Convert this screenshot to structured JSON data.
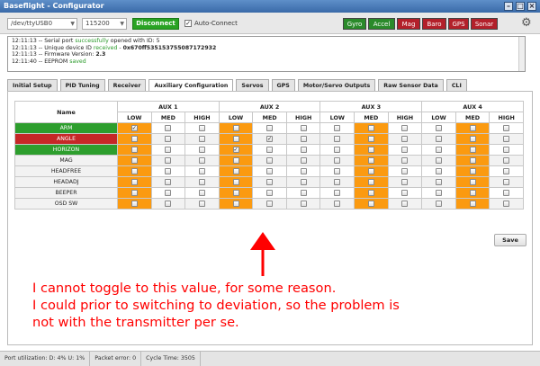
{
  "window": {
    "title": "Baseflight - Configurator",
    "buttons": [
      "–",
      "□",
      "×"
    ]
  },
  "header": {
    "port": "/dev/ttyUSB0",
    "baud": "115200",
    "connect_label": "Disconnect",
    "auto_connect_checked": true,
    "auto_connect_label": "Auto-Connect",
    "sensors": [
      {
        "label": "Gyro",
        "color": "#2a8a2a"
      },
      {
        "label": "Accel",
        "color": "#2a8a2a"
      },
      {
        "label": "Mag",
        "color": "#b3202a"
      },
      {
        "label": "Baro",
        "color": "#b3202a"
      },
      {
        "label": "GPS",
        "color": "#b3202a"
      },
      {
        "label": "Sonar",
        "color": "#b3202a"
      }
    ],
    "settings_icon": "gear-icon"
  },
  "log": [
    {
      "time": "12:11:13",
      "pre": "Serial port ",
      "ok": "successfully",
      "post": " opened with ID: 5",
      "bold": ""
    },
    {
      "time": "12:11:13",
      "pre": "Unique device ID ",
      "ok": "received",
      "post": " - ",
      "bold": "0x670ff535153755087172932"
    },
    {
      "time": "12:11:13",
      "pre": "Firmware Version: ",
      "ok": "",
      "post": "",
      "bold": "2.3"
    },
    {
      "time": "12:11:40",
      "pre": "EEPROM ",
      "ok": "saved",
      "post": "",
      "bold": ""
    }
  ],
  "tabs": [
    {
      "label": "Initial Setup",
      "active": false
    },
    {
      "label": "PID Tuning",
      "active": false
    },
    {
      "label": "Receiver",
      "active": false
    },
    {
      "label": "Auxiliary Configuration",
      "active": true
    },
    {
      "label": "Servos",
      "active": false
    },
    {
      "label": "GPS",
      "active": false
    },
    {
      "label": "Motor/Servo Outputs",
      "active": false
    },
    {
      "label": "Raw Sensor Data",
      "active": false
    },
    {
      "label": "CLI",
      "active": false
    }
  ],
  "aux_table": {
    "name_header": "Name",
    "aux_headers": [
      "AUX 1",
      "AUX 2",
      "AUX 3",
      "AUX 4"
    ],
    "level_headers": [
      "LOW",
      "MED",
      "HIGH"
    ],
    "rows": [
      {
        "name": "ARM",
        "status": "active",
        "checked": [
          1,
          0,
          0,
          0,
          0,
          0,
          0,
          0,
          0,
          0,
          0,
          0
        ]
      },
      {
        "name": "ANGLE",
        "status": "error",
        "checked": [
          0,
          0,
          0,
          0,
          1,
          0,
          0,
          0,
          0,
          0,
          0,
          0
        ]
      },
      {
        "name": "HORIZON",
        "status": "active",
        "checked": [
          0,
          0,
          0,
          1,
          0,
          0,
          0,
          0,
          0,
          0,
          0,
          0
        ]
      },
      {
        "name": "MAG",
        "status": "none",
        "checked": [
          0,
          0,
          0,
          0,
          0,
          0,
          0,
          0,
          0,
          0,
          0,
          0
        ]
      },
      {
        "name": "HEADFREE",
        "status": "none",
        "checked": [
          0,
          0,
          0,
          0,
          0,
          0,
          0,
          0,
          0,
          0,
          0,
          0
        ]
      },
      {
        "name": "HEADADJ",
        "status": "none",
        "checked": [
          0,
          0,
          0,
          0,
          0,
          0,
          0,
          0,
          0,
          0,
          0,
          0
        ]
      },
      {
        "name": "BEEPER",
        "status": "none",
        "checked": [
          0,
          0,
          0,
          0,
          0,
          0,
          0,
          0,
          0,
          0,
          0,
          0
        ]
      },
      {
        "name": "OSD SW",
        "status": "none",
        "checked": [
          0,
          0,
          0,
          0,
          0,
          0,
          0,
          0,
          0,
          0,
          0,
          0
        ]
      }
    ],
    "highlight_color": "#fb9a10"
  },
  "save_label": "Save",
  "annotation": {
    "color": "#ff0000",
    "lines": [
      "I cannot toggle to this value, for some reason.",
      "I could prior to switching to deviation, so the problem is",
      "not with the transmitter per se."
    ]
  },
  "status": {
    "port_util": "Port utilization: D: 4% U: 1%",
    "packet_error": "Packet error: 0",
    "cycle_time": "Cycle Time: 3505"
  }
}
